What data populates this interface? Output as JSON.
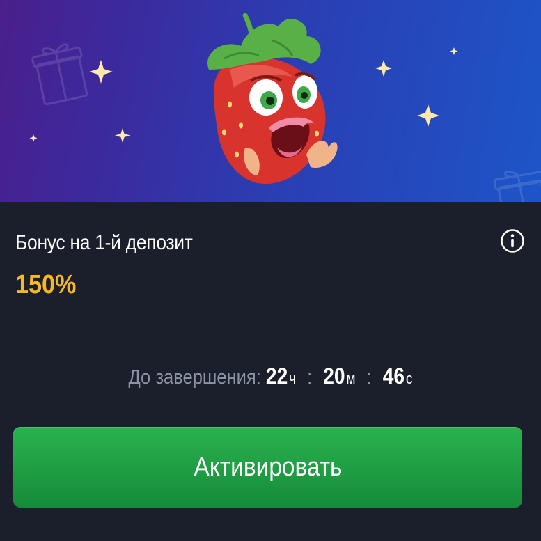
{
  "bonus": {
    "title": "Бонус на 1-й депозит",
    "percent": "150%"
  },
  "timer": {
    "label": "До завершения:",
    "hours": "22",
    "hours_unit": "ч",
    "minutes": "20",
    "minutes_unit": "м",
    "seconds": "46",
    "seconds_unit": "с",
    "separator": ":"
  },
  "actions": {
    "activate_label": "Активировать"
  },
  "icons": {
    "info": "info-icon",
    "mascot": "strawberry-mascot",
    "gift": "gift-icon",
    "sparkle": "sparkle-icon"
  },
  "colors": {
    "accent_yellow": "#f8b724",
    "button_green": "#1f9d43",
    "card_bg": "#1b1f2c",
    "muted_text": "#8c93a6"
  }
}
